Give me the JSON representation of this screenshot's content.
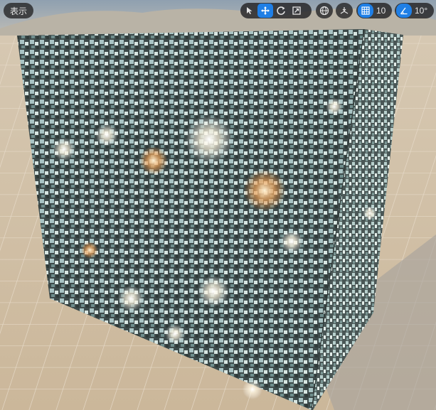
{
  "viewport": {
    "view_menu_label": "表示",
    "toolbar": {
      "select_icon": "cursor-icon",
      "move_icon": "move-arrows-icon",
      "rotate_icon": "rotate-icon",
      "scale_icon": "scale-icon",
      "world_local_icon": "globe-icon",
      "surface_snap_icon": "surface-snap-icon",
      "grid_snap_icon": "grid-icon",
      "grid_snap_value": "10",
      "rotation_snap_icon": "angle-icon",
      "rotation_snap_value": "10°"
    },
    "colors": {
      "accent": "#1f7fe6",
      "toolbar_bg": "#2a2a2c"
    }
  }
}
